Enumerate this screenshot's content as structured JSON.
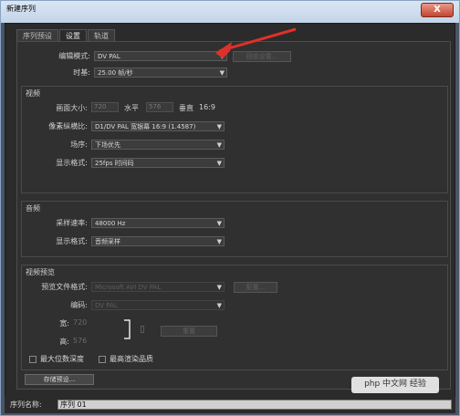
{
  "window": {
    "title": "新建序列",
    "close_symbol": "X"
  },
  "tabs": [
    {
      "label": "序列预设"
    },
    {
      "label": "设置"
    },
    {
      "label": "轨道"
    }
  ],
  "settings": {
    "editing_mode_label": "编辑模式:",
    "editing_mode_value": "DV PAL",
    "playback_settings_button": "回放设置...",
    "timebase_label": "时基:",
    "timebase_value": "25.00 帧/秒"
  },
  "video": {
    "title": "视频",
    "frame_size_label": "画面大小:",
    "frame_width": "720",
    "horizontal_label": "水平",
    "frame_height": "576",
    "vertical_label": "垂直",
    "aspect": "16:9",
    "pixel_aspect_label": "像素纵横比:",
    "pixel_aspect_value": "D1/DV PAL 宽银幕 16:9 (1.4587)",
    "fields_label": "场序:",
    "fields_value": "下场优先",
    "display_format_label": "显示格式:",
    "display_format_value": "25fps 时间码"
  },
  "audio": {
    "title": "音频",
    "sample_rate_label": "采样速率:",
    "sample_rate_value": "48000 Hz",
    "display_format_label": "显示格式:",
    "display_format_value": "音频采样"
  },
  "preview": {
    "title": "视频预览",
    "file_format_label": "预览文件格式:",
    "file_format_value": "Microsoft AVI DV PAL",
    "configure_button": "配置...",
    "codec_label": "编码:",
    "codec_value": "DV PAL",
    "width_label": "宽:",
    "width_value": "720",
    "height_label": "高:",
    "height_value": "576",
    "reset_button": "重置",
    "max_bit_depth_label": "最大位数深度",
    "max_render_quality_label": "最高渲染品质"
  },
  "save_preset_button": "存储预设...",
  "sequence_name_label": "序列名称:",
  "sequence_name_value": "序列 01",
  "watermark": "php 中文网 经验",
  "colors": {
    "annotation_arrow": "#e0302a",
    "background": "#2b2b2b"
  }
}
